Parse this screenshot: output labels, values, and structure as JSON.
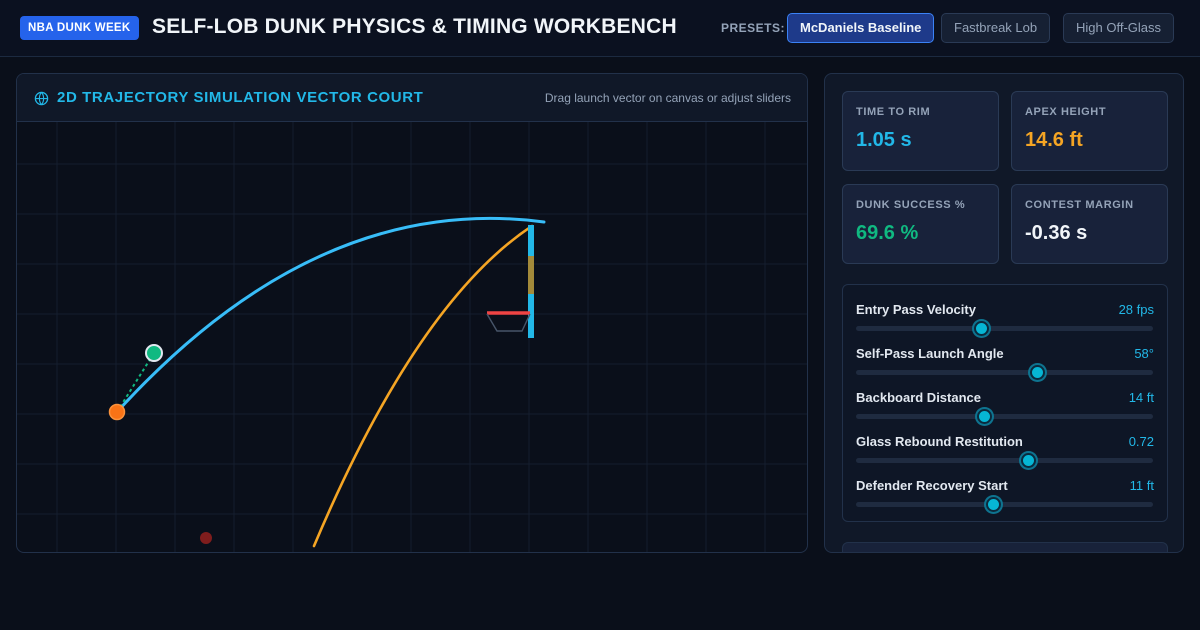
{
  "header": {
    "badge": "NBA DUNK WEEK",
    "title": "SELF-LOB DUNK PHYSICS & TIMING WORKBENCH",
    "presets_label": "PRESETS:",
    "presets": [
      {
        "label": "McDaniels Baseline",
        "active": true
      },
      {
        "label": "Fastbreak Lob",
        "active": false
      },
      {
        "label": "High Off-Glass",
        "active": false
      }
    ]
  },
  "simulation": {
    "icon": "globe-icon",
    "title": "2D TRAJECTORY SIMULATION VECTOR COURT",
    "hint": "Drag launch vector on canvas or adjust sliders"
  },
  "stats": [
    {
      "label": "TIME TO RIM",
      "value": "1.05 s",
      "color": "#22b8e8"
    },
    {
      "label": "APEX HEIGHT",
      "value": "14.6 ft",
      "color": "#f5a524"
    },
    {
      "label": "DUNK SUCCESS %",
      "value": "69.6 %",
      "color": "#10b981"
    },
    {
      "label": "CONTEST MARGIN",
      "value": "-0.36 s",
      "color": "#f1f5f9"
    }
  ],
  "sliders": [
    {
      "label": "Entry Pass Velocity",
      "value": "28 fps",
      "level": 0.42
    },
    {
      "label": "Self-Pass Launch Angle",
      "value": "58°",
      "level": 0.61
    },
    {
      "label": "Backboard Distance",
      "value": "14 ft",
      "level": 0.43
    },
    {
      "label": "Glass Rebound Restitution",
      "value": "0.72",
      "level": 0.58
    },
    {
      "label": "Defender Recovery Start",
      "value": "11 ft",
      "level": 0.46
    }
  ],
  "colors": {
    "accent": "#22b8e8",
    "ball_path": "#38bdf8",
    "rebound_path": "#f5a524",
    "launch_point": "#f97316",
    "release_point": "#10b981",
    "rim": "#ef4444",
    "backboard": "#22b8e8",
    "defender": "#7f1d1d"
  }
}
